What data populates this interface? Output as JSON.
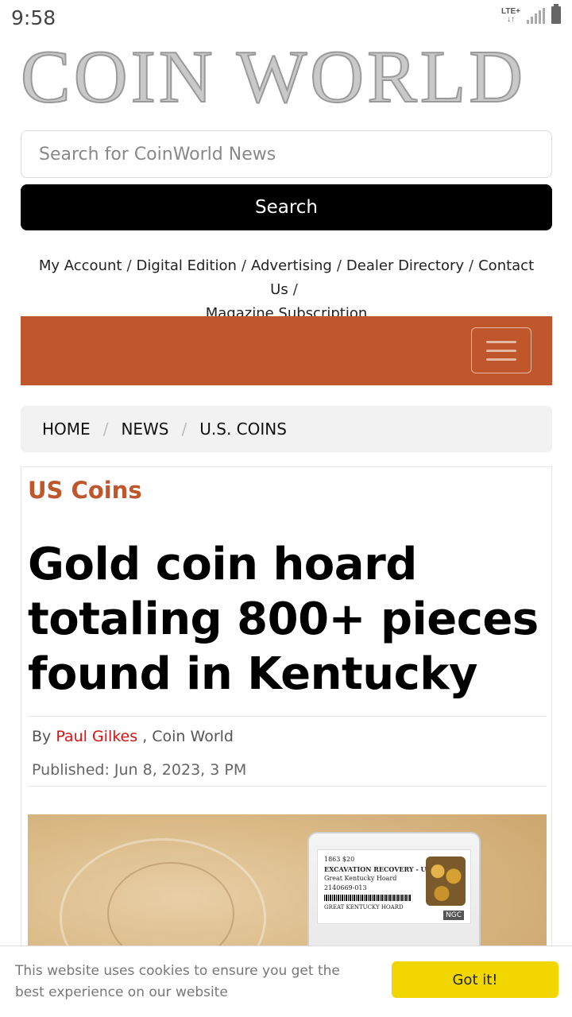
{
  "status_bar": {
    "time": "9:58",
    "network": "LTE+",
    "signal_icon": "signal-icon",
    "battery_icon": "battery-icon"
  },
  "logo": {
    "text": "COIN WORLD"
  },
  "search": {
    "placeholder": "Search for CoinWorld News",
    "button_label": "Search"
  },
  "top_nav": {
    "links": [
      "My Account",
      "Digital Edition",
      "Advertising",
      "Dealer Directory",
      "Contact Us",
      "Magazine Subscription"
    ],
    "separator": "/"
  },
  "nav_bar": {
    "color": "#c0562b",
    "menu_icon": "hamburger-menu-icon"
  },
  "breadcrumb": {
    "items": [
      "HOME",
      "NEWS",
      "U.S. COINS"
    ],
    "separator": "/"
  },
  "article": {
    "category": "US Coins",
    "headline": "Gold coin hoard totaling 800+ pieces found in Kentucky",
    "byline_prefix": "By",
    "author": "Paul Gilkes",
    "publication": ", Coin World",
    "published": "Published: Jun 8, 2023, 3 PM",
    "image_label": {
      "line1": "1863 $20",
      "line2": "EXCAVATION RECOVERY - UNC",
      "line3": "Great Kentucky Hoard",
      "line4": "2140669-013",
      "line5": "GREAT KENTUCKY HOARD",
      "grader": "NGC"
    }
  },
  "cookie_banner": {
    "message": "This website uses cookies to ensure you get the best experience on our website",
    "button_label": "Got it!"
  }
}
